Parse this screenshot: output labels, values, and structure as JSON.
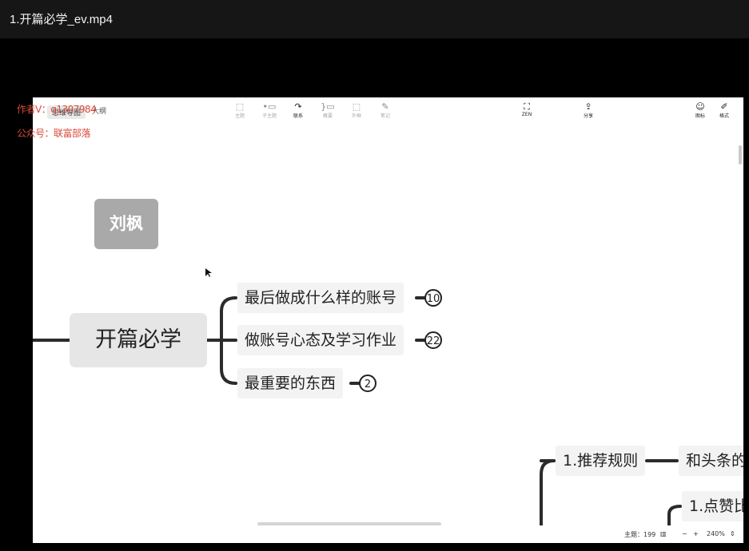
{
  "window": {
    "title": "1.开篇必学_ev.mp4"
  },
  "watermark": {
    "line1": "作者V：q1307984",
    "line2": "公众号：联富部落"
  },
  "toolbar": {
    "tabs": [
      {
        "label": "思维导图"
      },
      {
        "label": "大纲"
      }
    ],
    "tools": [
      {
        "label": "主题",
        "icon": "topic-icon"
      },
      {
        "label": "子主题",
        "icon": "subtopic-icon"
      },
      {
        "label": "联系",
        "icon": "relationship-icon"
      },
      {
        "label": "概要",
        "icon": "summary-icon"
      },
      {
        "label": "外框",
        "icon": "boundary-icon"
      },
      {
        "label": "笔记",
        "icon": "note-icon"
      }
    ],
    "zen": {
      "label": "ZEN"
    },
    "share": {
      "label": "分享"
    },
    "icons": {
      "label": "图标"
    },
    "format": {
      "label": "格式"
    }
  },
  "mindmap": {
    "floating_topic": "刘枫",
    "central_topic": "开篇必学",
    "subtopics": [
      {
        "label": "最后做成什么样的账号",
        "count": "10"
      },
      {
        "label": "做账号心态及学习作业",
        "count": "22"
      },
      {
        "label": "最重要的东西",
        "count": "2"
      }
    ],
    "lower_topic": "1.推荐规则",
    "lower_right_1": "和头条的",
    "lower_right_2": "1.点赞比"
  },
  "statusbar": {
    "topics": "主题：199",
    "zoom": "240%"
  }
}
